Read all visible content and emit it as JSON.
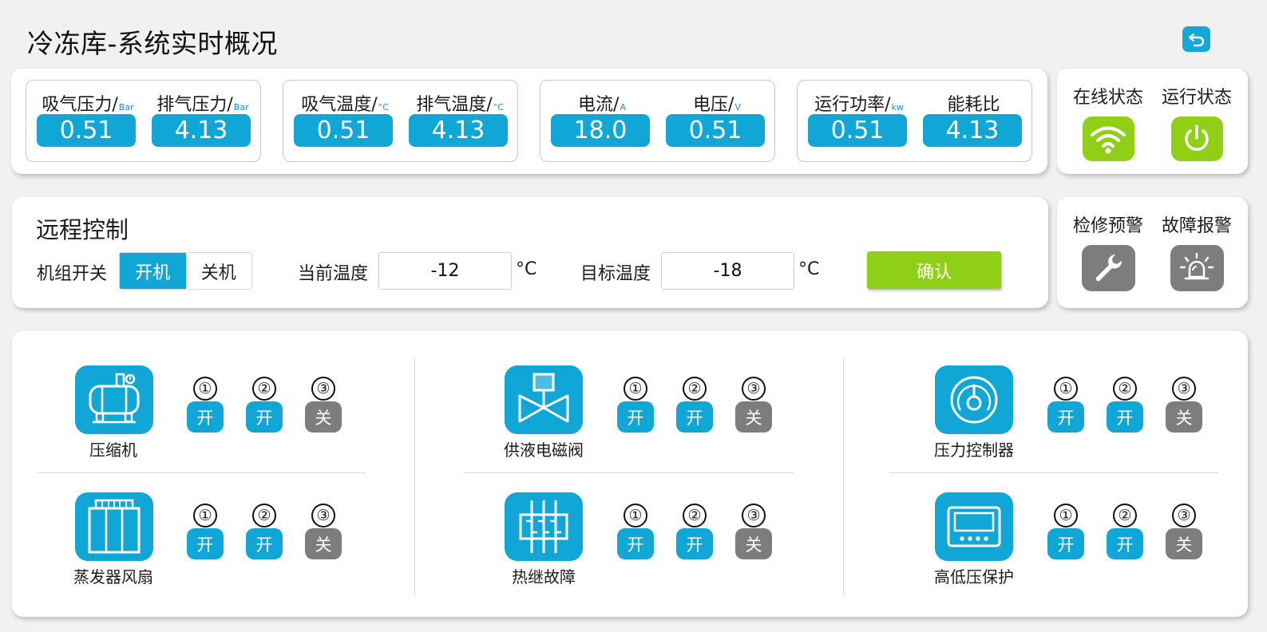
{
  "page": {
    "title": "冷冻库-系统实时概况"
  },
  "metrics": [
    {
      "label": "吸气压力/",
      "unit": "Bar",
      "value": "0.51"
    },
    {
      "label": "排气压力/",
      "unit": "Bar",
      "value": "4.13"
    },
    {
      "label": "吸气温度/",
      "unit": "°C",
      "value": "0.51"
    },
    {
      "label": "排气温度/",
      "unit": "°C",
      "value": "4.13"
    },
    {
      "label": "电流/",
      "unit": "A",
      "value": "18.0"
    },
    {
      "label": "电压/",
      "unit": "V",
      "value": "0.51"
    },
    {
      "label": "运行功率/",
      "unit": "kw",
      "value": "0.51"
    },
    {
      "label": "能耗比",
      "unit": "",
      "value": "4.13"
    }
  ],
  "status": {
    "online_label": "在线状态",
    "running_label": "运行状态"
  },
  "alarms": {
    "maintenance_label": "检修预警",
    "fault_label": "故障报警"
  },
  "remote": {
    "title": "远程控制",
    "unit_switch_label": "机组开关",
    "on_label": "开机",
    "off_label": "关机",
    "current_temp_label": "当前温度",
    "current_temp_value": "-12",
    "target_temp_label": "目标温度",
    "target_temp_value": "-18",
    "temp_unit": "°C",
    "confirm_label": "确认"
  },
  "devices": [
    {
      "name": "压缩机",
      "icon": "compressor-icon",
      "channels": [
        {
          "num": "①",
          "state": "开"
        },
        {
          "num": "②",
          "state": "开"
        },
        {
          "num": "③",
          "state": "关"
        }
      ]
    },
    {
      "name": "供液电磁阀",
      "icon": "solenoid-valve-icon",
      "channels": [
        {
          "num": "①",
          "state": "开"
        },
        {
          "num": "②",
          "state": "开"
        },
        {
          "num": "③",
          "state": "关"
        }
      ]
    },
    {
      "name": "压力控制器",
      "icon": "pressure-gauge-icon",
      "channels": [
        {
          "num": "①",
          "state": "开"
        },
        {
          "num": "②",
          "state": "开"
        },
        {
          "num": "③",
          "state": "关"
        }
      ]
    },
    {
      "name": "蒸发器风扇",
      "icon": "evaporator-fan-icon",
      "channels": [
        {
          "num": "①",
          "state": "开"
        },
        {
          "num": "②",
          "state": "开"
        },
        {
          "num": "③",
          "state": "关"
        }
      ]
    },
    {
      "name": "热继故障",
      "icon": "thermal-relay-icon",
      "channels": [
        {
          "num": "①",
          "state": "开"
        },
        {
          "num": "②",
          "state": "开"
        },
        {
          "num": "③",
          "state": "关"
        }
      ]
    },
    {
      "name": "高低压保护",
      "icon": "pressure-protector-icon",
      "channels": [
        {
          "num": "①",
          "state": "开"
        },
        {
          "num": "②",
          "state": "开"
        },
        {
          "num": "③",
          "state": "关"
        }
      ]
    }
  ],
  "colors": {
    "accent_blue": "#10a6d6",
    "status_green": "#8fd016",
    "inactive_grey": "#7d7d7d"
  }
}
